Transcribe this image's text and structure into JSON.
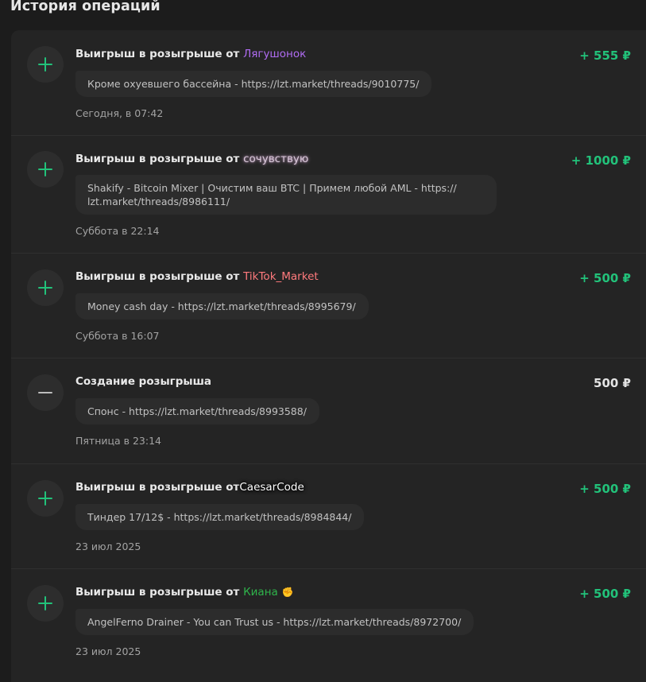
{
  "page": {
    "title": "История операций"
  },
  "operations": [
    {
      "type": "plus",
      "title": "Выигрыш в розыгрыше от",
      "user": "Лягушонок",
      "amount": "+ 555 ₽",
      "comment": "Кроме охуевшего бассейна - https://lzt.market/threads/9010775/",
      "date": "Сегодня, в 07:42"
    },
    {
      "type": "plus",
      "title": "Выигрыш в розыгрыше от",
      "user": "сочувствую",
      "amount": "+ 1000 ₽",
      "comment_line1": "Shakify - Bitcoin Mixer | Очистим ваш BTC | Примем любой AML - https://",
      "comment_line2": "lzt.market/threads/8986111/",
      "date": "Суббота в 22:14"
    },
    {
      "type": "plus",
      "title": "Выигрыш в розыгрыше от",
      "user": "TikTok_Market",
      "amount": "+ 500 ₽",
      "comment": "Money cash day - https://lzt.market/threads/8995679/",
      "date": "Суббота в 16:07"
    },
    {
      "type": "minus",
      "title": "Создание розыгрыша",
      "amount": "500 ₽",
      "comment": "Спонс - https://lzt.market/threads/8993588/",
      "date": "Пятница в 23:14"
    },
    {
      "type": "plus",
      "title": "Выигрыш в розыгрыше от",
      "user": "CaesarCode",
      "amount": "+ 500 ₽",
      "comment": "Тиндер 17/12$ - https://lzt.market/threads/8984844/",
      "date": "23 июл 2025"
    },
    {
      "type": "plus",
      "title": "Выигрыш в розыгрыше от",
      "user": "Киана",
      "user_badge_icon": "fist-icon",
      "amount": "+ 500 ₽",
      "comment": "AngelFerno Drainer - You can Trust us - https://lzt.market/threads/8972700/",
      "date": "23 июл 2025"
    }
  ],
  "colors": {
    "background": "#1c1c1c",
    "panel": "#242424",
    "positive_amount": "#22c27a",
    "comment_bubble": "#2c2c2c"
  }
}
